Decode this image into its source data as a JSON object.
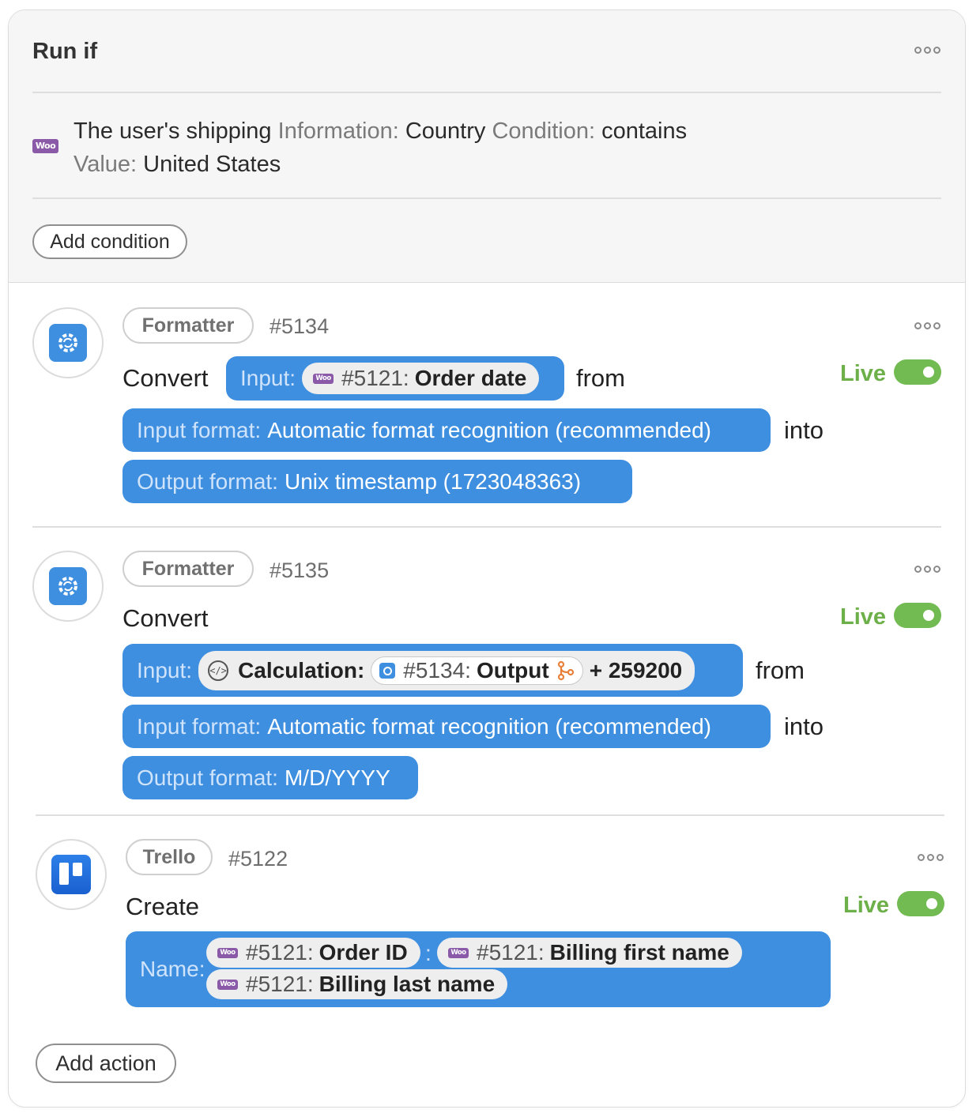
{
  "run_if": {
    "title": "Run if",
    "condition": {
      "prefix": "The user's shipping",
      "information_label": "Information:",
      "information_value": "Country",
      "condition_label": "Condition:",
      "condition_value": "contains",
      "value_label": "Value:",
      "value_value": "United States"
    },
    "add_condition_label": "Add condition"
  },
  "actions": [
    {
      "app": "Formatter",
      "id": "#5134",
      "verb": "Convert",
      "live_label": "Live",
      "input_label": "Input:",
      "input_chip_id": "#5121:",
      "input_chip_name": "Order date",
      "from_word": "from",
      "input_format_label": "Input format:",
      "input_format_value": "Automatic format recognition (recommended)",
      "into_word": "into",
      "output_format_label": "Output format:",
      "output_format_value": "Unix timestamp (1723048363)"
    },
    {
      "app": "Formatter",
      "id": "#5135",
      "verb": "Convert",
      "live_label": "Live",
      "input_label": "Input:",
      "calc_label": "Calculation:",
      "calc_ref_id": "#5134:",
      "calc_ref_name": "Output",
      "calc_suffix": "+ 259200",
      "from_word": "from",
      "input_format_label": "Input format:",
      "input_format_value": "Automatic format recognition (recommended)",
      "into_word": "into",
      "output_format_label": "Output format:",
      "output_format_value": "M/D/YYYY"
    },
    {
      "app": "Trello",
      "id": "#5122",
      "verb": "Create",
      "live_label": "Live",
      "name_label": "Name:",
      "chip1_id": "#5121:",
      "chip1_name": "Order ID",
      "separator": ":",
      "chip2_id": "#5121:",
      "chip2_name": "Billing first name",
      "chip3_id": "#5121:",
      "chip3_name": "Billing last name"
    }
  ],
  "woo_badge": "Woo",
  "add_action_label": "Add action",
  "colors": {
    "accent": "#3f8fe0",
    "live": "#6db04a",
    "woo": "#8a5aa8"
  }
}
